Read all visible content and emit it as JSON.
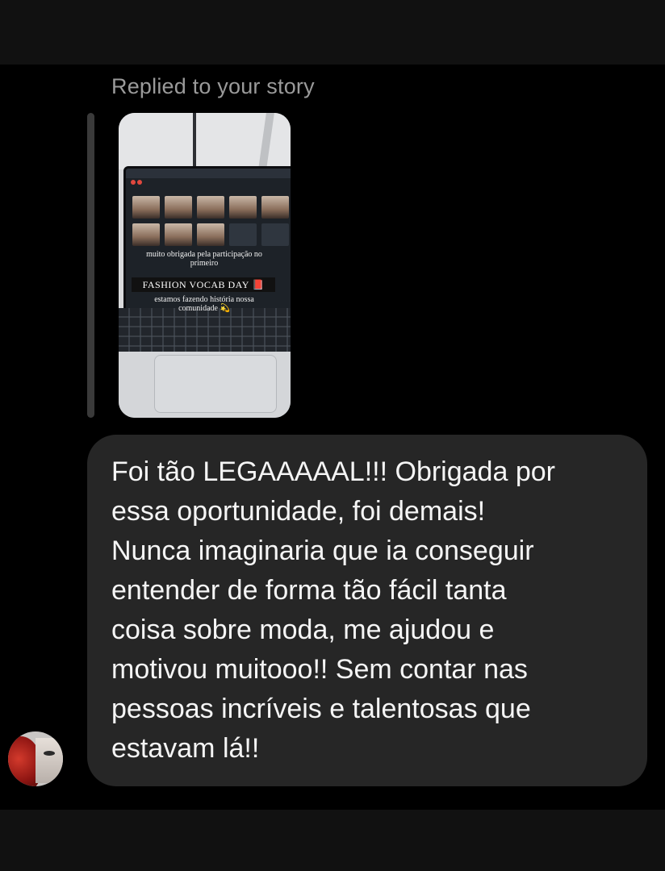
{
  "reply": {
    "label": "Replied to your story"
  },
  "story": {
    "caption_top": "muito obrigada pela participação no primeiro",
    "caption_badge": "FASHION VOCAB DAY 📕",
    "caption_bottom": "estamos fazendo história nossa comunidade 💫"
  },
  "message": {
    "text": "Foi tão LEGAAAAAL!!! Obrigada por\nessa oportunidade, foi demais!\nNunca imaginaria que ia conseguir\nentender de forma tão fácil tanta\ncoisa sobre moda, me ajudou e\nmotivou muitooo!! Sem contar nas\npessoas incríveis e talentosas que\nestavam lá!!"
  },
  "colors": {
    "chat_background": "#000000",
    "bubble": "#262626",
    "message_text": "#f5f5f5",
    "reply_label": "#9a9a9a"
  },
  "icons": {
    "avatar": "sender-avatar"
  }
}
